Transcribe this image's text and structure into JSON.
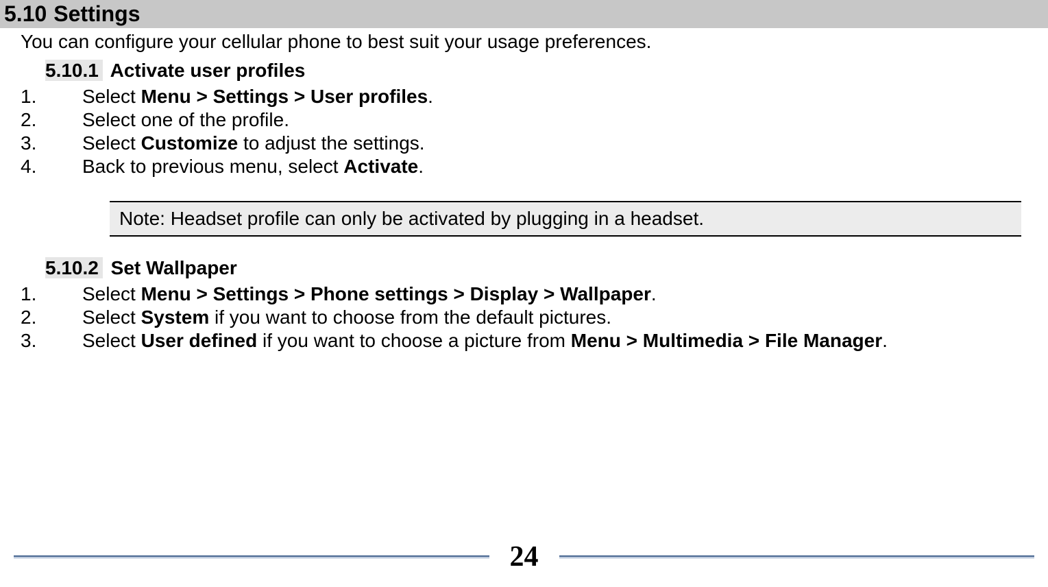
{
  "section": {
    "number": "5.10",
    "title": "Settings"
  },
  "intro": "You can configure your cellular phone to best suit your usage preferences.",
  "sub1": {
    "number": "5.10.1",
    "title": "Activate user profiles",
    "steps": [
      {
        "n": "1.",
        "pre": "Select ",
        "bold": "Menu > Settings > User profiles",
        "post": "."
      },
      {
        "n": "2.",
        "pre": "Select one of the profile.",
        "bold": "",
        "post": ""
      },
      {
        "n": "3.",
        "pre": "Select ",
        "bold": "Customize",
        "post": " to adjust the settings."
      },
      {
        "n": "4.",
        "pre": "Back to previous menu, select ",
        "bold": "Activate",
        "post": "."
      }
    ]
  },
  "note": "Note: Headset profile can only be activated by plugging in a headset.",
  "sub2": {
    "number": "5.10.2",
    "title": "Set Wallpaper",
    "steps": [
      {
        "n": "1.",
        "pre": "Select ",
        "bold": "Menu > Settings > Phone settings > Display > Wallpaper",
        "post": "."
      },
      {
        "n": "2.",
        "pre": "Select ",
        "bold": "System",
        "post": " if you want to choose from the default pictures."
      },
      {
        "n": "3.",
        "pre": "Select ",
        "bold": "User defined",
        "mid": " if you want to choose a picture from ",
        "bold2": "Menu > Multimedia > File Manager",
        "post": "."
      }
    ]
  },
  "page_number": "24"
}
